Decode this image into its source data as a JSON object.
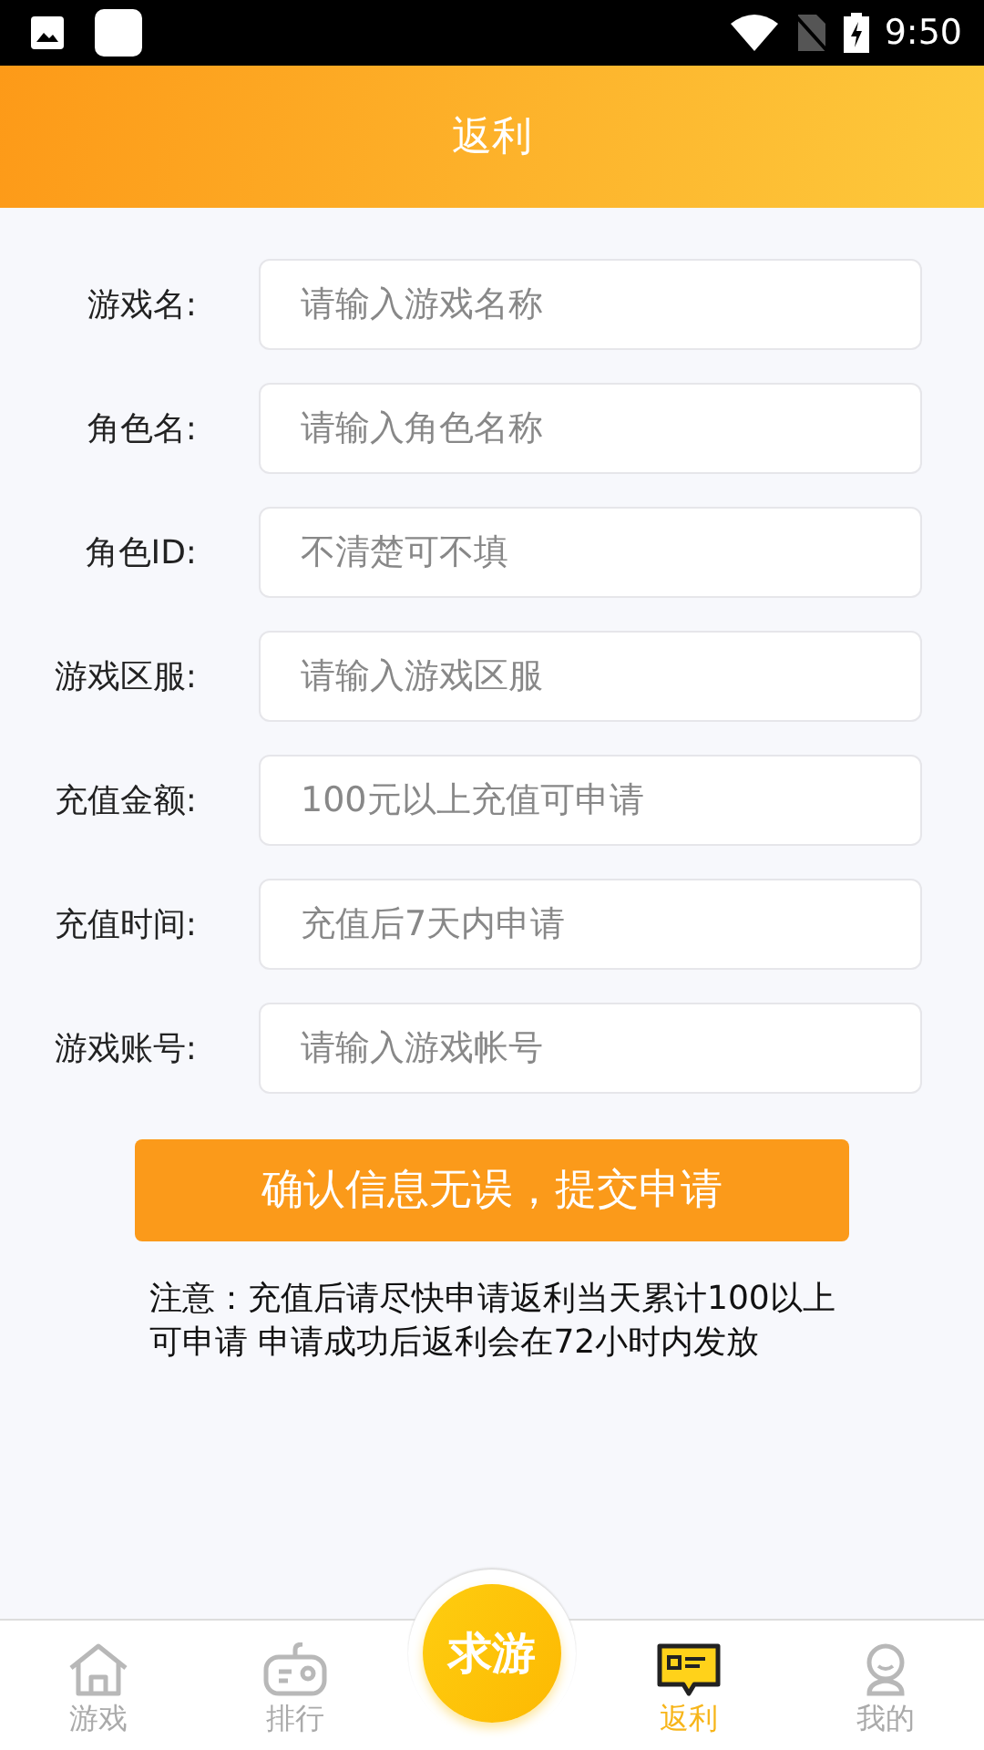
{
  "status_bar": {
    "time": "9:50"
  },
  "header": {
    "title": "返利"
  },
  "form": {
    "fields": [
      {
        "label": "游戏名:",
        "placeholder": "请输入游戏名称"
      },
      {
        "label": "角色名:",
        "placeholder": "请输入角色名称"
      },
      {
        "label": "角色ID:",
        "placeholder": "不清楚可不填"
      },
      {
        "label": "游戏区服:",
        "placeholder": "请输入游戏区服"
      },
      {
        "label": "充值金额:",
        "placeholder": "100元以上充值可申请"
      },
      {
        "label": "充值时间:",
        "placeholder": "充值后7天内申请"
      },
      {
        "label": "游戏账号:",
        "placeholder": "请输入游戏帐号"
      }
    ],
    "submit": "确认信息无误，提交申请",
    "note": "注意：充值后请尽快申请返利当天累计100以上可申请 申请成功后返利会在72小时内发放"
  },
  "tab_bar": {
    "tabs": [
      {
        "label": "游戏",
        "selected": false
      },
      {
        "label": "排行",
        "selected": false
      },
      {
        "label": "返利",
        "selected": true
      },
      {
        "label": "我的",
        "selected": false
      }
    ],
    "center_button": "求游"
  }
}
